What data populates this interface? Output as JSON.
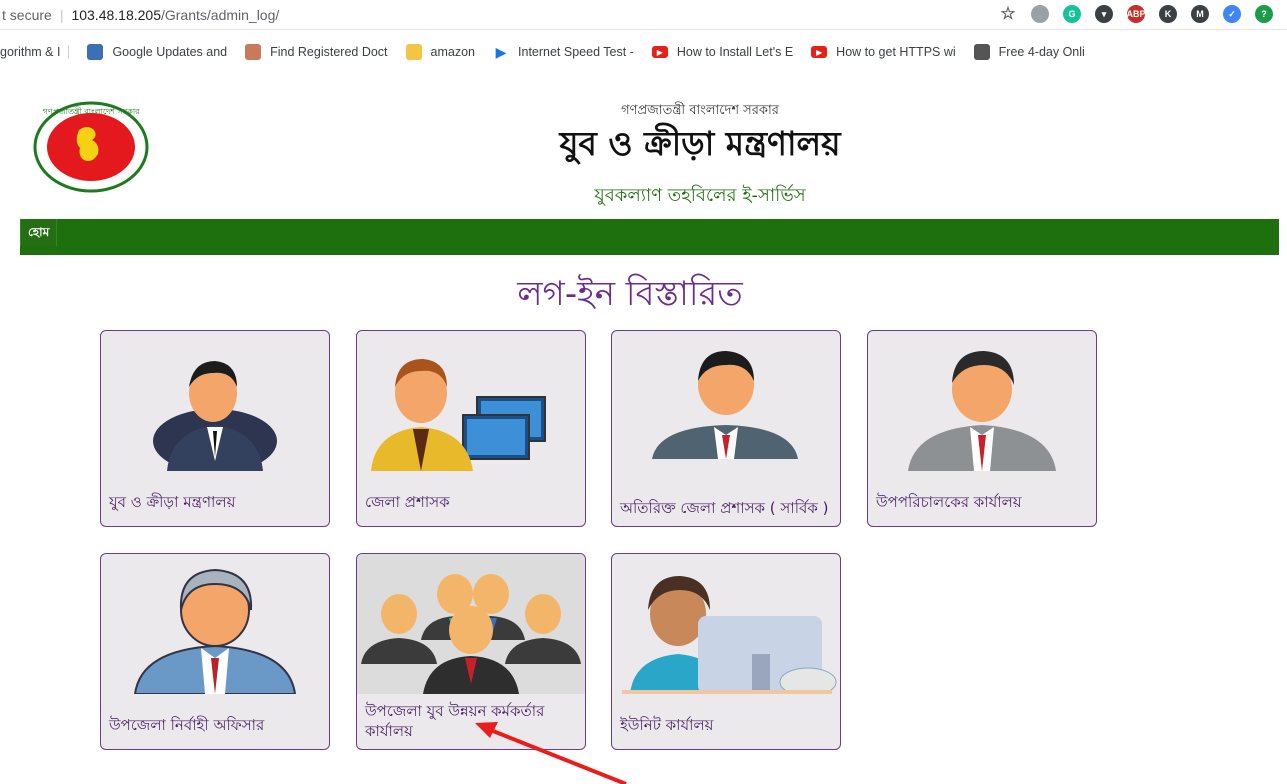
{
  "browser": {
    "secure_label": "t secure",
    "url_host": "103.48.18.205",
    "url_path": "/Grants/admin_log/",
    "extensions": [
      {
        "name": "star-icon",
        "color": "#5f6368",
        "text": "☆"
      },
      {
        "name": "globe-icon",
        "color": "#9aa0a6",
        "text": ""
      },
      {
        "name": "grammarly-icon",
        "color": "#15c39a",
        "text": "G"
      },
      {
        "name": "pocket-icon",
        "color": "#3c4043",
        "text": "▾"
      },
      {
        "name": "adblock-icon",
        "color": "#c4302b",
        "text": "ABP"
      },
      {
        "name": "k-extension-icon",
        "color": "#3c4043",
        "text": "K"
      },
      {
        "name": "m-extension-icon",
        "color": "#3c4043",
        "text": "M"
      },
      {
        "name": "blue-check-icon",
        "color": "#4285f4",
        "text": "✓"
      },
      {
        "name": "question-extension-icon",
        "color": "#1a9c4a",
        "text": "?"
      }
    ]
  },
  "bookmarks": [
    {
      "label": "gorithm & I",
      "icon": "",
      "color": ""
    },
    {
      "label": "Google Updates and",
      "icon": "google-updates-icon",
      "color": "#3d6fb4"
    },
    {
      "label": "Find Registered Doct",
      "icon": "doctor-site-icon",
      "color": "#c97a5a"
    },
    {
      "label": "amazon",
      "icon": "folder-icon",
      "color": "#f4c542"
    },
    {
      "label": "Internet Speed Test -",
      "icon": "play-arrow-icon",
      "color": "#1a73e8"
    },
    {
      "label": "How to Install Let's E",
      "icon": "youtube-icon",
      "color": "#e62117"
    },
    {
      "label": "How to get HTTPS wi",
      "icon": "youtube-icon",
      "color": "#e62117"
    },
    {
      "label": "Free 4-day Onli",
      "icon": "free-course-icon",
      "color": "#555555"
    }
  ],
  "header": {
    "gov_line": "গণপ্রজাতন্ত্রী বাংলাদেশ সরকার",
    "ministry": "যুব ও ক্রীড়া মন্ত্রণালয়",
    "tagline": "যুবকল্যাণ তহবিলের ই-সার্ভিস",
    "logo_ring_text": "গণপ্রজাতন্ত্রী বাংলাদেশ সরকার",
    "colors": {
      "tagline": "#1f6e0c",
      "nav": "#1e6f0e",
      "heading": "#6b2d8c"
    }
  },
  "nav": {
    "home": "হোম"
  },
  "page": {
    "heading": "লগ-ইন বিস্তারিত"
  },
  "cards": [
    {
      "label": "যুব ও ক্রীড়া মন্ত্রণালয়",
      "icon": "businessman-icon"
    },
    {
      "label": "জেলা প্রশাসক",
      "icon": "computer-operator-icon"
    },
    {
      "label": "অতিরিক্ত জেলা প্রশাসক ( সার্বিক )",
      "icon": "man-red-tie-icon"
    },
    {
      "label": "উপপরিচালকের কার্যালয়",
      "icon": "man-grey-suit-icon"
    },
    {
      "label": "উপজেলা নির্বাহী অফিসার",
      "icon": "grey-hair-man-icon"
    },
    {
      "label": "উপজেলা যুব উন্নয়ন কর্মকর্তার কার্যালয়",
      "icon": "team-icon"
    },
    {
      "label": "ইউনিট কার্যালয়",
      "icon": "person-computer-icon"
    }
  ]
}
